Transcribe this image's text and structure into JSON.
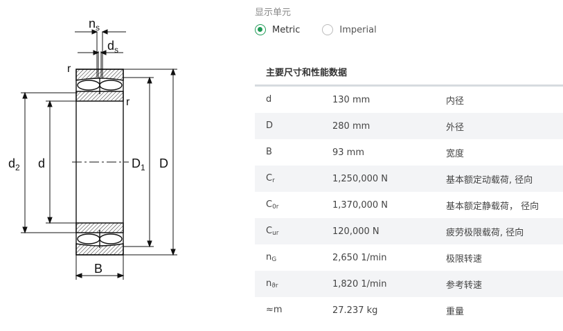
{
  "drawing": {
    "labels": {
      "ns": "n",
      "ns_sub": "s",
      "ds": "d",
      "ds_sub": "s",
      "r_top": "r",
      "r_right": "r",
      "d2": "d",
      "d2_sub": "2",
      "d": "d",
      "D1": "D",
      "D1_sub": "1",
      "D": "D",
      "B": "B"
    }
  },
  "units": {
    "title": "显示单元",
    "options": [
      {
        "label": "Metric",
        "selected": true
      },
      {
        "label": "Imperial",
        "selected": false
      }
    ]
  },
  "section": {
    "title": "主要尺寸和性能数据"
  },
  "rows": [
    {
      "sym": "d",
      "sub": "",
      "value": "130 mm",
      "desc": "内径"
    },
    {
      "sym": "D",
      "sub": "",
      "value": "280 mm",
      "desc": "外径"
    },
    {
      "sym": "B",
      "sub": "",
      "value": "93 mm",
      "desc": "宽度"
    },
    {
      "sym": "C",
      "sub": "r",
      "value": "1,250,000 N",
      "desc": "基本额定动载荷, 径向"
    },
    {
      "sym": "C",
      "sub": "0r",
      "value": "1,370,000 N",
      "desc": "基本额定静载荷， 径向"
    },
    {
      "sym": "C",
      "sub": "ur",
      "value": "120,000 N",
      "desc": "疲劳极限载荷, 径向"
    },
    {
      "sym": "n",
      "sub": "G",
      "value": "2,650 1/min",
      "desc": "极限转速"
    },
    {
      "sym": "n",
      "sub": "ϑr",
      "value": "1,820 1/min",
      "desc": "参考转速"
    },
    {
      "sym": "≈m",
      "sub": "",
      "value": "27.237 kg",
      "desc": "重量"
    }
  ]
}
